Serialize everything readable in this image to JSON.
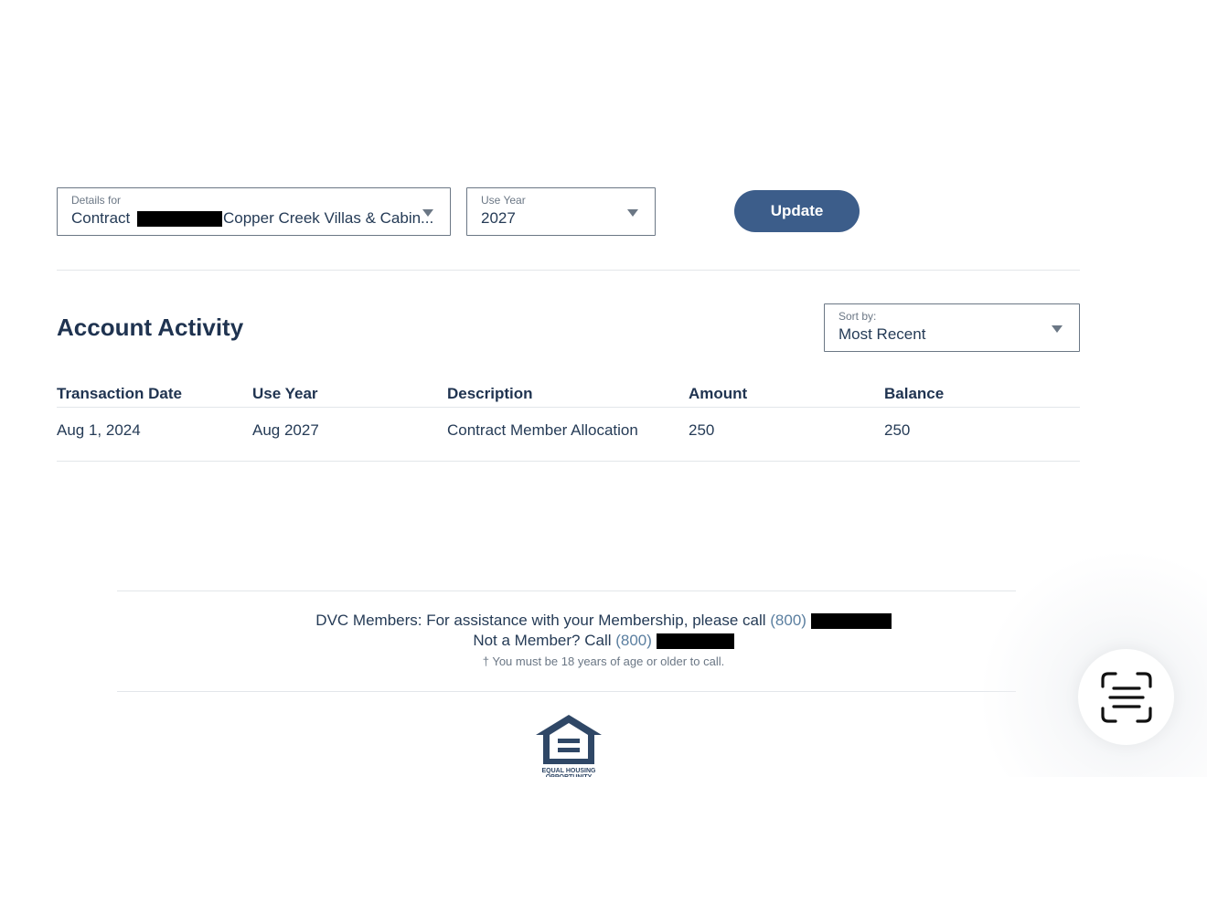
{
  "filters": {
    "details": {
      "label": "Details for",
      "value_prefix": "Contract",
      "value_suffix": "Copper Creek Villas & Cabin..."
    },
    "use_year": {
      "label": "Use Year",
      "value": "2027"
    },
    "update_label": "Update"
  },
  "activity": {
    "title": "Account Activity",
    "sort": {
      "label": "Sort by:",
      "value": "Most Recent"
    },
    "columns": [
      "Transaction Date",
      "Use Year",
      "Description",
      "Amount",
      "Balance"
    ],
    "rows": [
      [
        "Aug 1, 2024",
        "Aug 2027",
        "Contract Member Allocation",
        "250",
        "250"
      ]
    ]
  },
  "footer": {
    "members_text": "DVC Members: For assistance with your Membership, please call",
    "members_phone": "(800)",
    "nonmember_text": "Not a Member? Call",
    "nonmember_phone": "(800)",
    "age_note": "† You must be 18 years of age or older to call.",
    "logo_text": "EQUAL HOUSING OPPORTUNITY"
  },
  "colors": {
    "primary": "#3c5d8a",
    "text": "#253b56",
    "link": "#5b7fa0"
  },
  "icons": [
    "chevron-down-icon",
    "equal-housing-logo",
    "text-scan-icon"
  ]
}
